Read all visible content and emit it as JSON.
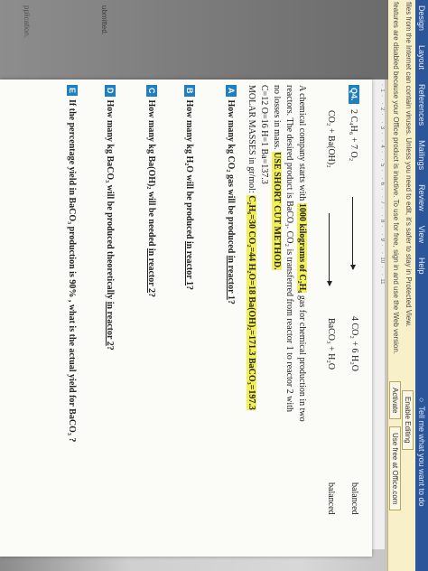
{
  "ribbon": {
    "tabs": [
      "Design",
      "Layout",
      "References",
      "Mailings",
      "Review",
      "View",
      "Help"
    ],
    "tell_me": "Tell me what you want to do"
  },
  "protected_view": {
    "line1": "files from the Internet can contain viruses. Unless you need to edit, it's safer to stay in Protected View.",
    "line2": "features are disabled because your Office product is inactive. To use for free, sign in and use the Web version.",
    "enable_editing": "Enable Editing",
    "activate": "Activate",
    "use_free": "Use free at Office.com"
  },
  "sidebar": {
    "text1": "ubmitted.",
    "text2": "pplication."
  },
  "document": {
    "q4_label": "Q4.",
    "eq1_left": "2 C₄H₆  +  7 O₂",
    "eq1_right": "4 CO₂  +  6 H₂O",
    "eq1_note": "balanced",
    "eq2_left": "CO₂  +  Ba(OH)₂",
    "eq2_right": "BaCO₃  +  H₂O",
    "eq2_note": "balanced",
    "para1_a": "A chemical company starts with ",
    "para1_hl1": "1000 kilograms of C₂H₆",
    "para1_b": " gas for chemical production in two",
    "para2": "reactors. The desired product is BaCO₃. CO₂ is transferred from reactor 1 to reactor 2 with",
    "para3_a": "no losses in mass. ",
    "para3_hl": "USE SHORT CUT METHOD.",
    "atomic": "C=12  O=16  H=1  Ba=137.3",
    "molar_a": "MOLAR MASSES in gr/mol:  ",
    "molar_hl": "C₂H₆=30  CO₂=44  H₂O=18  Ba(OH)₂=171.3   BaCO₃=197.3",
    "qA_badge": "A",
    "qA_text": "How many kg CO₂ gas will be produced ",
    "qA_u": "in reactor 1",
    "qA_end": "?",
    "qB_badge": "B",
    "qB_text": "How many kg H₂O will be produced ",
    "qB_u": "in reactor 1",
    "qB_end": "?",
    "qC_badge": "C",
    "qC_text": "How many kg Ba(OH)₂ will be needed ",
    "qC_u": "in reactor 2",
    "qC_end": "?",
    "qD_badge": "D",
    "qD_text": "How many kg BaCO₃ will be produced theoretically ",
    "qD_u": "in reactor 2",
    "qD_end": "?",
    "qE_badge": "E",
    "qE_text": "If the percentage yield in BaCO₃ production is 90% , what is the actual yield for BaCO₃ ?"
  },
  "colors": {
    "ribbon": "#2b579a",
    "protected_view": "#f7f0c8",
    "highlight": "#f3ef5a",
    "badge": "#1f7fbf"
  }
}
